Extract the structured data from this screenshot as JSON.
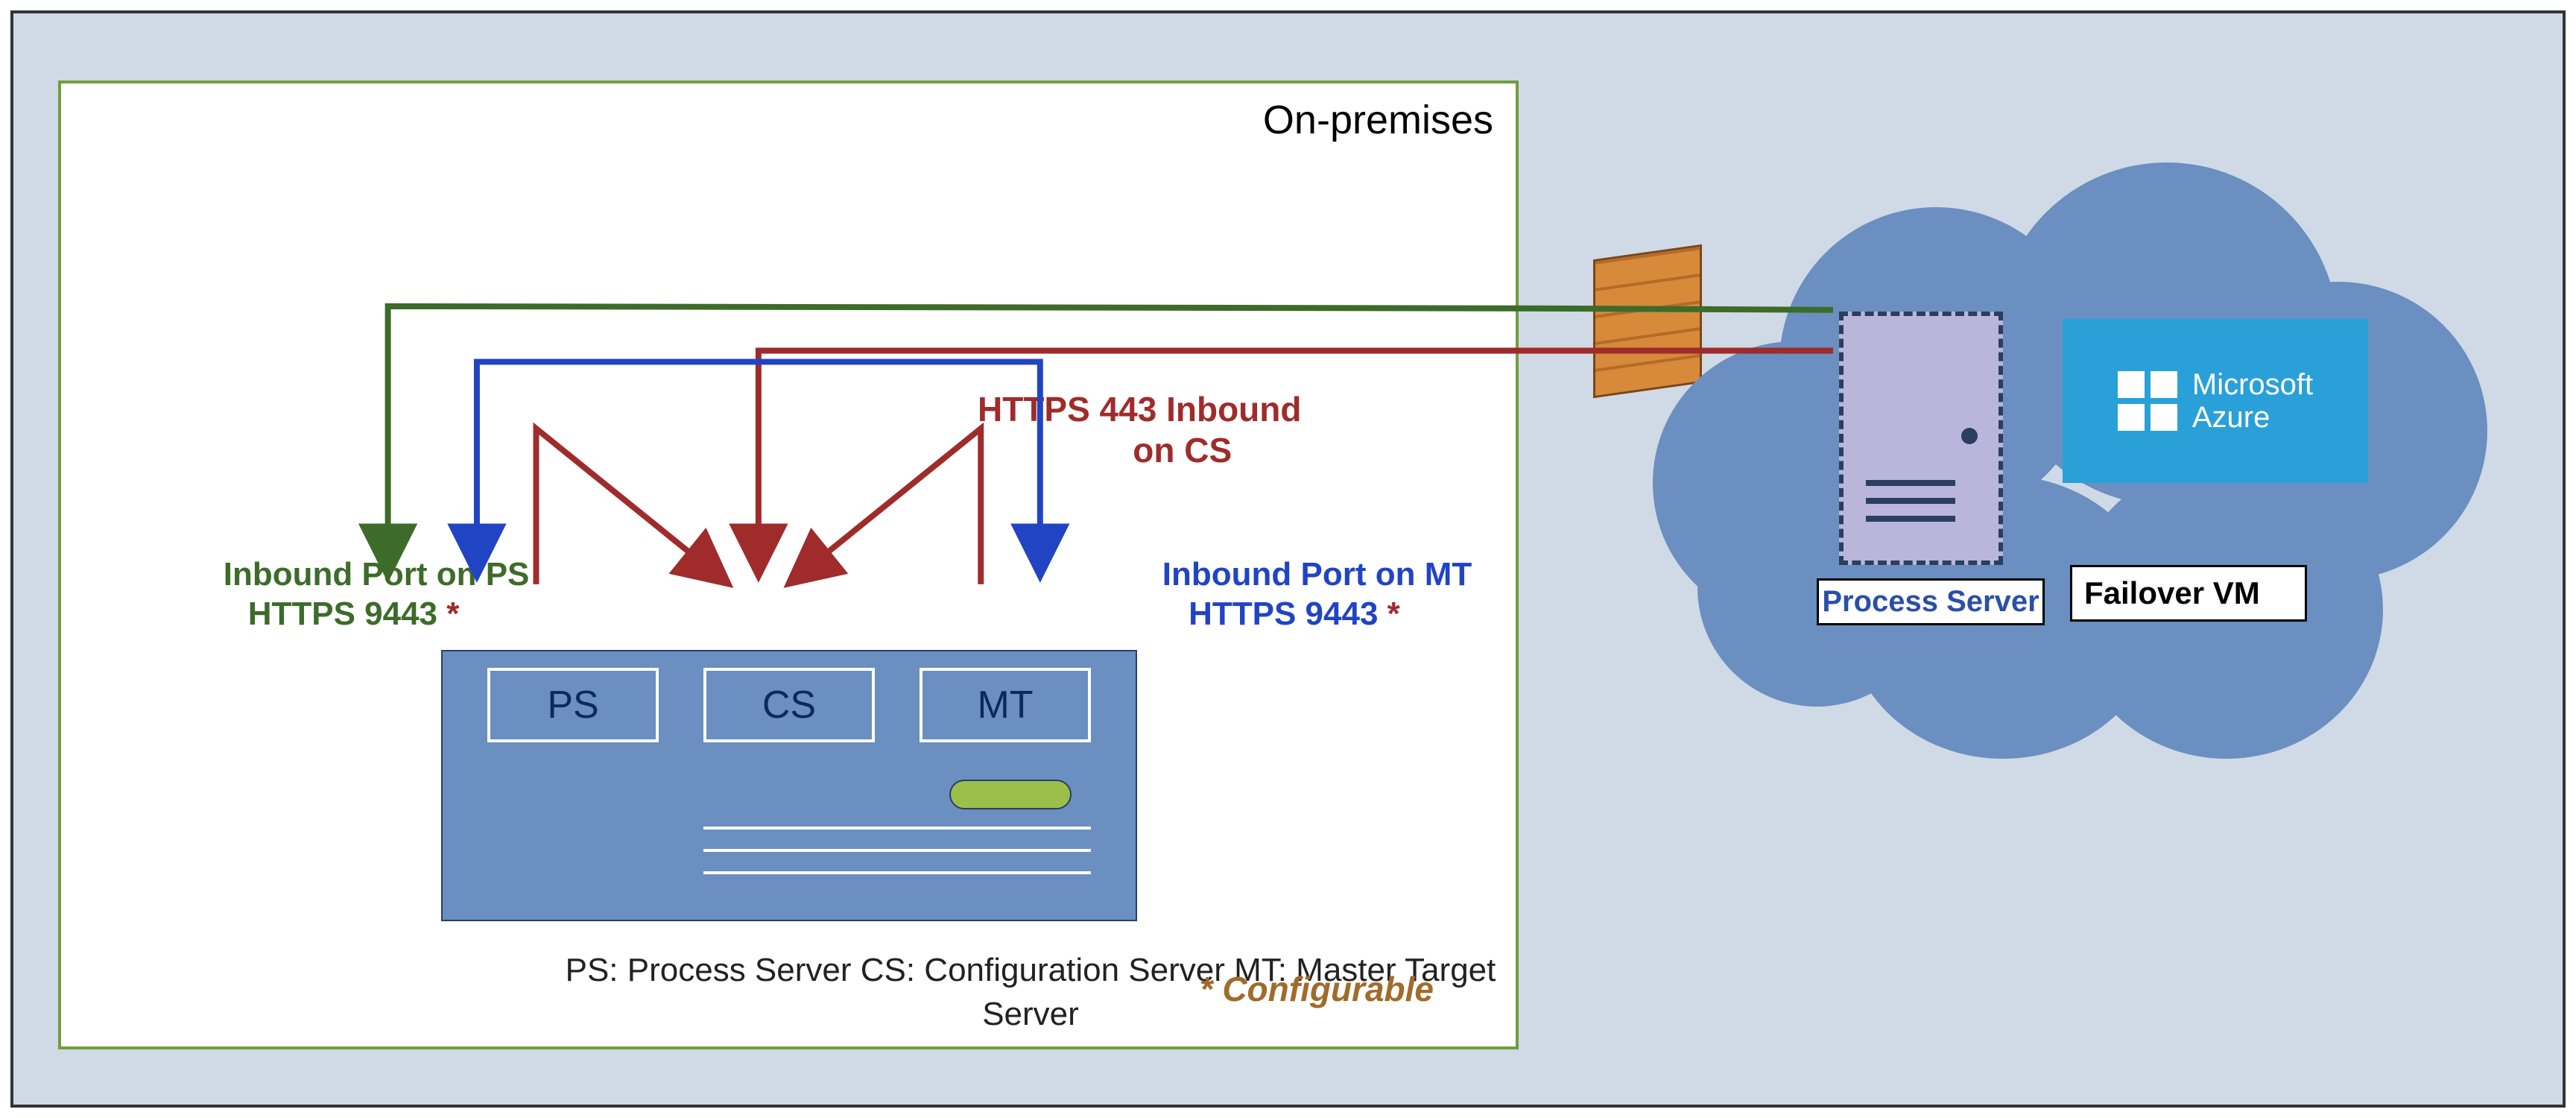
{
  "onprem": {
    "title": "On-premises",
    "server": {
      "slots": {
        "ps": "PS",
        "cs": "CS",
        "mt": "MT"
      }
    },
    "labels": {
      "ps": "Inbound Port on PS\n   HTTPS 9443 ",
      "cs": "HTTPS 443 Inbound\n         on CS",
      "mt": "Inbound Port on MT\n   HTTPS 9443 "
    },
    "legend": "PS: Process Server\nCS: Configuration Server\nMT: Master Target Server",
    "configurable": "* Configurable"
  },
  "cloud": {
    "process_server_label": "Process Server",
    "failover_vm_label": "Failover\nVM",
    "azure_brand_top": "Microsoft",
    "azure_brand_bottom": "Azure"
  },
  "colors": {
    "green": "#3d6b2a",
    "red": "#a02b2b",
    "blue": "#2144c4",
    "steel": "#6a8fc0"
  },
  "asterisk": "*"
}
